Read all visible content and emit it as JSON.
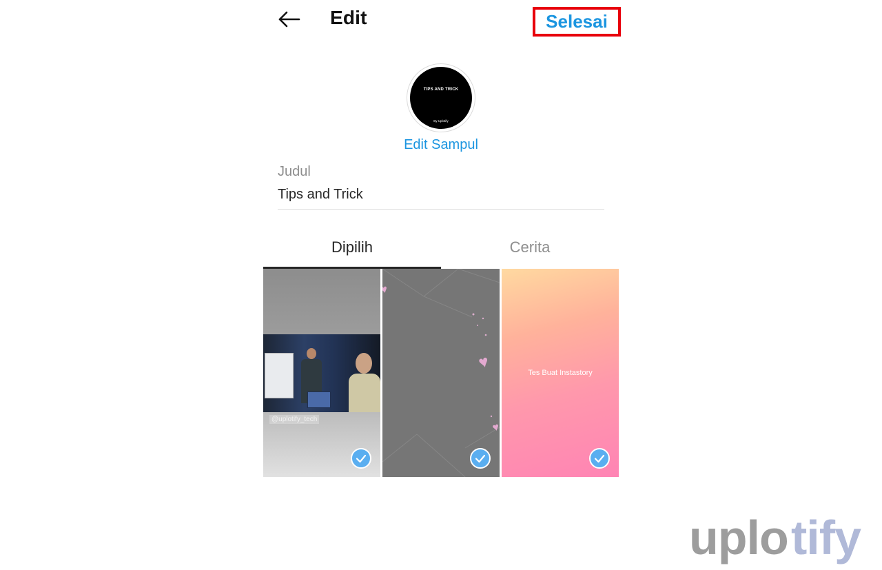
{
  "header": {
    "back_icon": "arrow-left-icon",
    "title": "Edit",
    "done_label": "Selesai",
    "done_highlight_color": "#e8000b"
  },
  "cover": {
    "title": "TIPS AND TRICK",
    "subtitle": "By Uplotify",
    "edit_label": "Edit Sampul"
  },
  "title_field": {
    "label": "Judul",
    "value": "Tips and Trick"
  },
  "tabs": [
    {
      "label": "Dipilih",
      "selected": true
    },
    {
      "label": "Cerita",
      "selected": false
    }
  ],
  "stories": [
    {
      "caption": "@uplotify_tech",
      "selected": true
    },
    {
      "caption": "",
      "selected": true
    },
    {
      "caption": "Tes Buat Instastory",
      "selected": true
    }
  ],
  "colors": {
    "accent": "#1b95e0",
    "check_badge": "#5aaef0",
    "text_primary": "#262626",
    "text_secondary": "#8e8e8e"
  },
  "watermark": {
    "text": "uplotify"
  }
}
